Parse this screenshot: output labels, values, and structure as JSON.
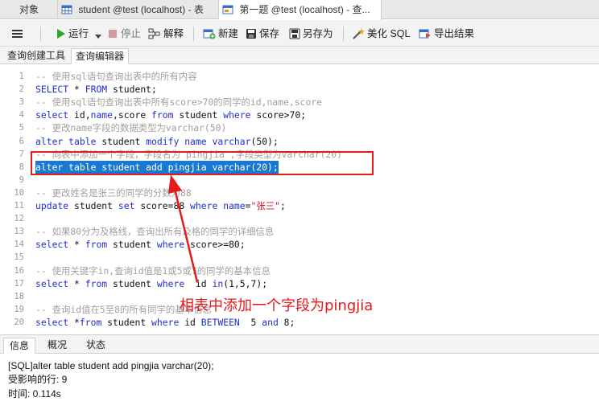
{
  "tabs": [
    {
      "label": "对象"
    },
    {
      "label": "student @test (localhost) - 表"
    },
    {
      "label": "第一题 @test (localhost) - 查..."
    }
  ],
  "toolbar": {
    "run": "运行",
    "stop": "停止",
    "explain": "解释",
    "new": "新建",
    "save": "保存",
    "save_as": "另存为",
    "beautify": "美化 SQL",
    "export": "导出结果"
  },
  "subtabs": [
    {
      "label": "查询创建工具"
    },
    {
      "label": "查询编辑器"
    }
  ],
  "editor": {
    "lines": [
      {
        "n": "1",
        "tokens": [
          {
            "t": "-- 使用sql语句查询出表中的所有内容",
            "c": "cm"
          }
        ]
      },
      {
        "n": "2",
        "tokens": [
          {
            "t": "SELECT",
            "c": "kw"
          },
          {
            "t": " * ",
            "c": "pl"
          },
          {
            "t": "FROM",
            "c": "kw"
          },
          {
            "t": " student;",
            "c": "pl"
          }
        ]
      },
      {
        "n": "3",
        "tokens": [
          {
            "t": "-- 使用sql语句查询出表中所有score>70的同学的id,name,score",
            "c": "cm"
          }
        ]
      },
      {
        "n": "4",
        "tokens": [
          {
            "t": "select",
            "c": "kw"
          },
          {
            "t": " id,",
            "c": "pl"
          },
          {
            "t": "name",
            "c": "kw"
          },
          {
            "t": ",score ",
            "c": "pl"
          },
          {
            "t": "from",
            "c": "kw"
          },
          {
            "t": " student ",
            "c": "pl"
          },
          {
            "t": "where",
            "c": "kw"
          },
          {
            "t": " score>70;",
            "c": "pl"
          }
        ]
      },
      {
        "n": "5",
        "tokens": [
          {
            "t": "-- 更改name字段的数据类型为varchar(50)",
            "c": "cm"
          }
        ]
      },
      {
        "n": "6",
        "tokens": [
          {
            "t": "alter",
            "c": "kw"
          },
          {
            "t": " ",
            "c": "pl"
          },
          {
            "t": "table",
            "c": "kw"
          },
          {
            "t": " student ",
            "c": "pl"
          },
          {
            "t": "modify",
            "c": "kw"
          },
          {
            "t": " ",
            "c": "pl"
          },
          {
            "t": "name",
            "c": "kw"
          },
          {
            "t": " ",
            "c": "pl"
          },
          {
            "t": "varchar",
            "c": "kw"
          },
          {
            "t": "(50);",
            "c": "pl"
          }
        ]
      },
      {
        "n": "7",
        "tokens": [
          {
            "t": "-- 向表中添加一个字段，字段名为 pingjia ,字段类型为varchar(20)",
            "c": "cm"
          }
        ]
      },
      {
        "n": "8",
        "sel": true,
        "tokens": [
          {
            "t": "alter table student add pingjia varchar(20);",
            "c": "pl"
          }
        ]
      },
      {
        "n": "9",
        "tokens": []
      },
      {
        "n": "10",
        "tokens": [
          {
            "t": "-- 更改姓名是张三的同学的分数为88",
            "c": "cm"
          }
        ]
      },
      {
        "n": "11",
        "tokens": [
          {
            "t": "update",
            "c": "kw"
          },
          {
            "t": " student ",
            "c": "pl"
          },
          {
            "t": "set",
            "c": "kw"
          },
          {
            "t": " score=88 ",
            "c": "pl"
          },
          {
            "t": "where",
            "c": "kw"
          },
          {
            "t": " ",
            "c": "pl"
          },
          {
            "t": "name",
            "c": "kw"
          },
          {
            "t": "=",
            "c": "pl"
          },
          {
            "t": "\"张三\"",
            "c": "st"
          },
          {
            "t": ";",
            "c": "pl"
          }
        ]
      },
      {
        "n": "12",
        "tokens": []
      },
      {
        "n": "13",
        "tokens": [
          {
            "t": "-- 如果80分为及格线，查询出所有及格的同学的详细信息",
            "c": "cm"
          }
        ]
      },
      {
        "n": "14",
        "tokens": [
          {
            "t": "select",
            "c": "kw"
          },
          {
            "t": " * ",
            "c": "pl"
          },
          {
            "t": "from",
            "c": "kw"
          },
          {
            "t": " student ",
            "c": "pl"
          },
          {
            "t": "where",
            "c": "kw"
          },
          {
            "t": " score>=80;",
            "c": "pl"
          }
        ]
      },
      {
        "n": "15",
        "tokens": []
      },
      {
        "n": "16",
        "tokens": [
          {
            "t": "-- 使用关键字in,查询id值是1或5或7的同学的基本信息",
            "c": "cm"
          }
        ]
      },
      {
        "n": "17",
        "tokens": [
          {
            "t": "select",
            "c": "kw"
          },
          {
            "t": " * ",
            "c": "pl"
          },
          {
            "t": "from",
            "c": "kw"
          },
          {
            "t": " student ",
            "c": "pl"
          },
          {
            "t": "where",
            "c": "kw"
          },
          {
            "t": "  id ",
            "c": "pl"
          },
          {
            "t": "in",
            "c": "kw"
          },
          {
            "t": "(1,5,7);",
            "c": "pl"
          }
        ]
      },
      {
        "n": "18",
        "tokens": []
      },
      {
        "n": "19",
        "tokens": [
          {
            "t": "-- 查询id值在5至8的所有同学的基本信息",
            "c": "cm"
          }
        ]
      },
      {
        "n": "20",
        "tokens": [
          {
            "t": "select",
            "c": "kw"
          },
          {
            "t": " *",
            "c": "pl"
          },
          {
            "t": "from",
            "c": "kw"
          },
          {
            "t": " student ",
            "c": "pl"
          },
          {
            "t": "where",
            "c": "kw"
          },
          {
            "t": " id ",
            "c": "pl"
          },
          {
            "t": "BETWEEN",
            "c": "kw"
          },
          {
            "t": "  5 ",
            "c": "pl"
          },
          {
            "t": "and",
            "c": "kw"
          },
          {
            "t": " 8;",
            "c": "pl"
          }
        ]
      }
    ]
  },
  "annotation": {
    "text": "相表中添加一个字段为pingjia",
    "color": "#e8171c"
  },
  "bottom_tabs": [
    {
      "label": "信息"
    },
    {
      "label": "概况"
    },
    {
      "label": "状态"
    }
  ],
  "info": {
    "sql": "[SQL]alter table student add pingjia varchar(20);",
    "affected": "受影响的行: 9",
    "time": "时间: 0.114s"
  }
}
